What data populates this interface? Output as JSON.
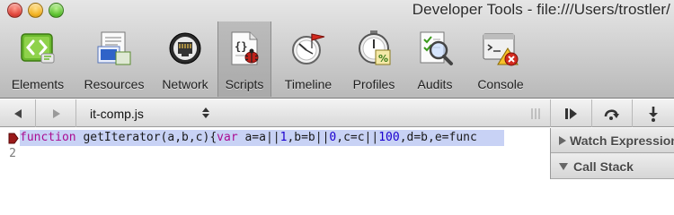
{
  "window": {
    "title": "Developer Tools - file:///Users/trostler/"
  },
  "toolbar": {
    "items": [
      {
        "label": "Elements",
        "icon": "elements-icon"
      },
      {
        "label": "Resources",
        "icon": "resources-icon"
      },
      {
        "label": "Network",
        "icon": "network-icon"
      },
      {
        "label": "Scripts",
        "icon": "scripts-icon",
        "selected": true
      },
      {
        "label": "Timeline",
        "icon": "timeline-icon"
      },
      {
        "label": "Profiles",
        "icon": "profiles-icon"
      },
      {
        "label": "Audits",
        "icon": "audits-icon"
      },
      {
        "label": "Console",
        "icon": "console-icon"
      }
    ]
  },
  "scripts": {
    "selected_file": "it-comp.js"
  },
  "source": {
    "lines": [
      {
        "number": "1",
        "text": "function getIterator(a,b,c){var a=a||1,b=b||0,c=c||100,d=b,e=func",
        "breakpoint": true
      },
      {
        "number": "2",
        "text": ""
      }
    ]
  },
  "sidebar": {
    "watch_label": "Watch Expressions",
    "callstack_label": "Call Stack"
  },
  "colors": {
    "highlight_line": "#c8d2f5",
    "keyword": "#aa0d91",
    "number": "#1c00cf",
    "breakpoint": "#9a1a1a"
  }
}
